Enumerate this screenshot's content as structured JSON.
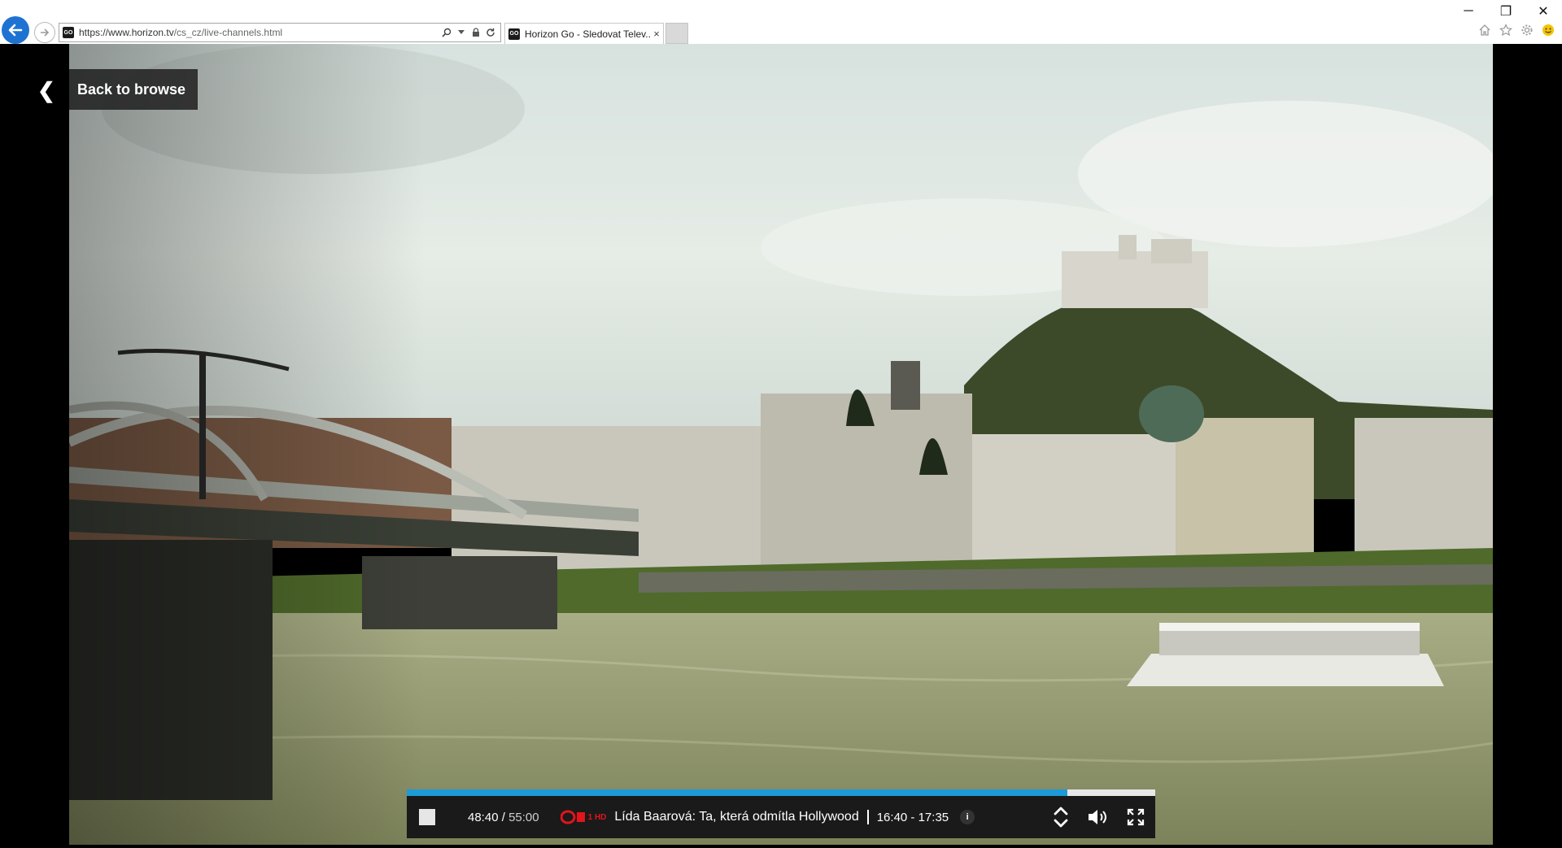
{
  "browser": {
    "url": "https://www.horizon.tv/cs_cz/live-channels.html",
    "url_host": "https://www.horizon.tv",
    "url_path": "/cs_cz/live-channels.html",
    "site_badge": "GO",
    "tab_title": "Horizon Go - Sledovat Telev...",
    "tab_close": "×",
    "icons": [
      "back-arrow-icon",
      "forward-arrow-icon",
      "search-icon",
      "dropdown-icon",
      "lock-icon",
      "refresh-icon",
      "home-icon",
      "star-icon",
      "gear-icon",
      "smiley-icon"
    ]
  },
  "window_controls": {
    "minimize": "─",
    "restore": "❐",
    "close": "✕"
  },
  "overlay": {
    "back_chevron": "❮",
    "back_label": "Back to browse"
  },
  "player": {
    "elapsed": "48:40",
    "separator": " / ",
    "duration": "55:00",
    "progress_fraction": 0.8826,
    "channel": "1 HD",
    "title": "Lída Baarová: Ta, která odmítla Hollywood",
    "timeslot": "16:40 - 17:35",
    "info": "i",
    "colors": {
      "progress": "#1c9bd8",
      "bar_bg": "#1a1a1a",
      "channel_red": "#e2141c"
    }
  }
}
